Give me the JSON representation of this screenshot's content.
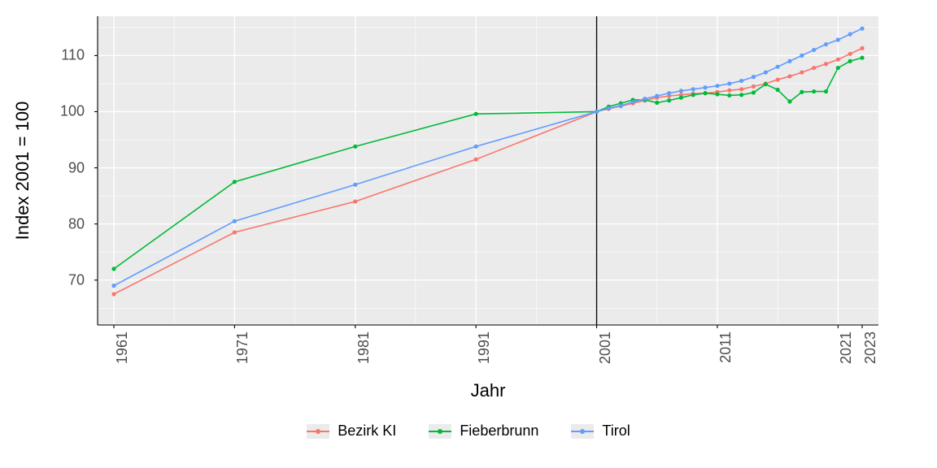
{
  "chart_data": {
    "type": "line",
    "xlabel": "Jahr",
    "ylabel": "Index 2001 = 100",
    "ylim": [
      62,
      117
    ],
    "x_ticks": [
      1961,
      1971,
      1981,
      1991,
      2001,
      2011,
      2021,
      2023
    ],
    "y_ticks": [
      70,
      80,
      90,
      100,
      110
    ],
    "reference_x": 2001,
    "series": [
      {
        "name": "Bezirk KI",
        "color": "#f8766d",
        "x": [
          1961,
          1971,
          1981,
          1991,
          2001,
          2002,
          2003,
          2004,
          2005,
          2006,
          2007,
          2008,
          2009,
          2010,
          2011,
          2012,
          2013,
          2014,
          2015,
          2016,
          2017,
          2018,
          2019,
          2020,
          2021,
          2022,
          2023
        ],
        "y": [
          67.5,
          78.5,
          84.0,
          91.5,
          100.0,
          100.5,
          101.0,
          101.5,
          102.0,
          102.5,
          102.8,
          103.0,
          103.2,
          103.3,
          103.5,
          103.8,
          104.0,
          104.5,
          105.0,
          105.7,
          106.3,
          107.0,
          107.8,
          108.5,
          109.3,
          110.3,
          111.3
        ]
      },
      {
        "name": "Fieberbrunn",
        "color": "#00ba38",
        "x": [
          1961,
          1971,
          1981,
          1991,
          2001,
          2002,
          2003,
          2004,
          2005,
          2006,
          2007,
          2008,
          2009,
          2010,
          2011,
          2012,
          2013,
          2014,
          2015,
          2016,
          2017,
          2018,
          2019,
          2020,
          2021,
          2022,
          2023
        ],
        "y": [
          72.0,
          87.5,
          93.8,
          99.6,
          100.0,
          100.9,
          101.5,
          102.1,
          102.1,
          101.6,
          102.0,
          102.5,
          103.0,
          103.3,
          103.1,
          102.9,
          103.0,
          103.4,
          104.9,
          103.9,
          101.8,
          103.5,
          103.6,
          103.6,
          107.8,
          109.0,
          109.6
        ]
      },
      {
        "name": "Tirol",
        "color": "#619cff",
        "x": [
          1961,
          1971,
          1981,
          1991,
          2001,
          2002,
          2003,
          2004,
          2005,
          2006,
          2007,
          2008,
          2009,
          2010,
          2011,
          2012,
          2013,
          2014,
          2015,
          2016,
          2017,
          2018,
          2019,
          2020,
          2021,
          2022,
          2023
        ],
        "y": [
          69.0,
          80.5,
          87.0,
          93.8,
          100.0,
          100.6,
          101.1,
          101.7,
          102.3,
          102.8,
          103.3,
          103.7,
          104.0,
          104.3,
          104.6,
          105.0,
          105.5,
          106.2,
          107.0,
          108.0,
          109.0,
          110.0,
          111.0,
          112.0,
          112.8,
          113.8,
          114.8
        ]
      }
    ]
  },
  "legend": [
    "Bezirk KI",
    "Fieberbrunn",
    "Tirol"
  ],
  "legend_colors": [
    "#f8766d",
    "#00ba38",
    "#619cff"
  ]
}
